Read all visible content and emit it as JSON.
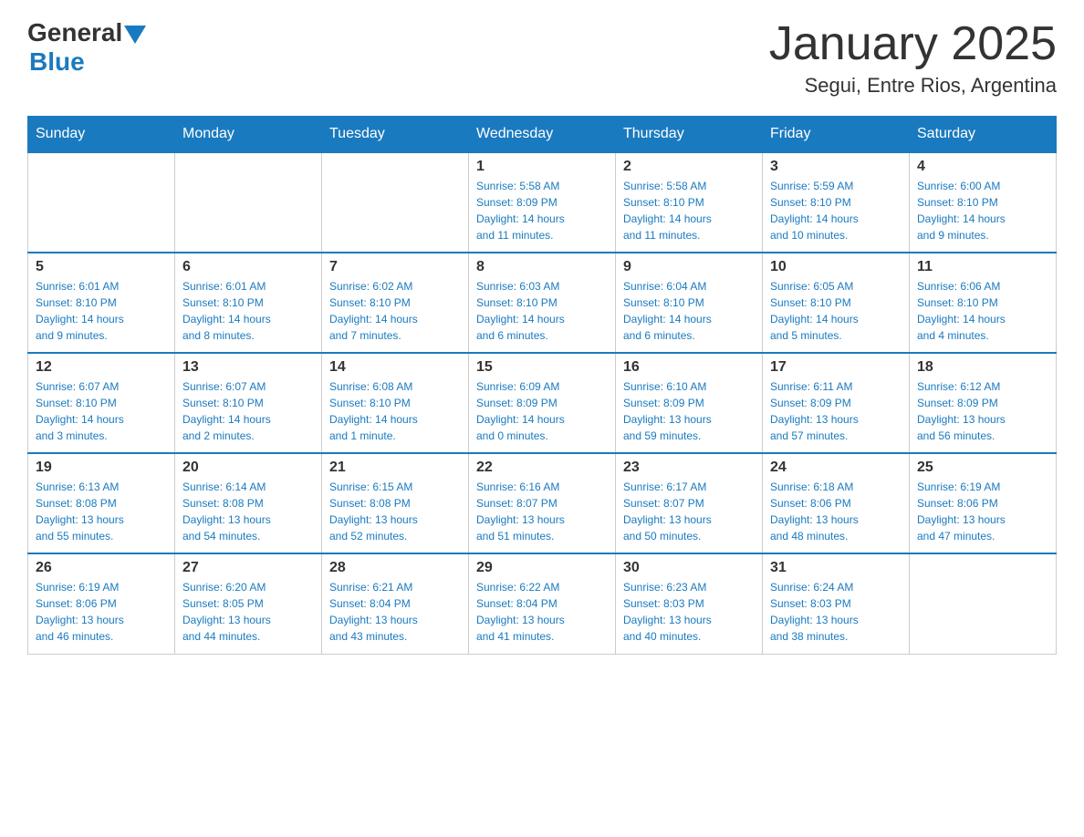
{
  "header": {
    "logo_general": "General",
    "logo_blue": "Blue",
    "title": "January 2025",
    "subtitle": "Segui, Entre Rios, Argentina"
  },
  "columns": [
    "Sunday",
    "Monday",
    "Tuesday",
    "Wednesday",
    "Thursday",
    "Friday",
    "Saturday"
  ],
  "weeks": [
    [
      {
        "day": "",
        "info": ""
      },
      {
        "day": "",
        "info": ""
      },
      {
        "day": "",
        "info": ""
      },
      {
        "day": "1",
        "info": "Sunrise: 5:58 AM\nSunset: 8:09 PM\nDaylight: 14 hours\nand 11 minutes."
      },
      {
        "day": "2",
        "info": "Sunrise: 5:58 AM\nSunset: 8:10 PM\nDaylight: 14 hours\nand 11 minutes."
      },
      {
        "day": "3",
        "info": "Sunrise: 5:59 AM\nSunset: 8:10 PM\nDaylight: 14 hours\nand 10 minutes."
      },
      {
        "day": "4",
        "info": "Sunrise: 6:00 AM\nSunset: 8:10 PM\nDaylight: 14 hours\nand 9 minutes."
      }
    ],
    [
      {
        "day": "5",
        "info": "Sunrise: 6:01 AM\nSunset: 8:10 PM\nDaylight: 14 hours\nand 9 minutes."
      },
      {
        "day": "6",
        "info": "Sunrise: 6:01 AM\nSunset: 8:10 PM\nDaylight: 14 hours\nand 8 minutes."
      },
      {
        "day": "7",
        "info": "Sunrise: 6:02 AM\nSunset: 8:10 PM\nDaylight: 14 hours\nand 7 minutes."
      },
      {
        "day": "8",
        "info": "Sunrise: 6:03 AM\nSunset: 8:10 PM\nDaylight: 14 hours\nand 6 minutes."
      },
      {
        "day": "9",
        "info": "Sunrise: 6:04 AM\nSunset: 8:10 PM\nDaylight: 14 hours\nand 6 minutes."
      },
      {
        "day": "10",
        "info": "Sunrise: 6:05 AM\nSunset: 8:10 PM\nDaylight: 14 hours\nand 5 minutes."
      },
      {
        "day": "11",
        "info": "Sunrise: 6:06 AM\nSunset: 8:10 PM\nDaylight: 14 hours\nand 4 minutes."
      }
    ],
    [
      {
        "day": "12",
        "info": "Sunrise: 6:07 AM\nSunset: 8:10 PM\nDaylight: 14 hours\nand 3 minutes."
      },
      {
        "day": "13",
        "info": "Sunrise: 6:07 AM\nSunset: 8:10 PM\nDaylight: 14 hours\nand 2 minutes."
      },
      {
        "day": "14",
        "info": "Sunrise: 6:08 AM\nSunset: 8:10 PM\nDaylight: 14 hours\nand 1 minute."
      },
      {
        "day": "15",
        "info": "Sunrise: 6:09 AM\nSunset: 8:09 PM\nDaylight: 14 hours\nand 0 minutes."
      },
      {
        "day": "16",
        "info": "Sunrise: 6:10 AM\nSunset: 8:09 PM\nDaylight: 13 hours\nand 59 minutes."
      },
      {
        "day": "17",
        "info": "Sunrise: 6:11 AM\nSunset: 8:09 PM\nDaylight: 13 hours\nand 57 minutes."
      },
      {
        "day": "18",
        "info": "Sunrise: 6:12 AM\nSunset: 8:09 PM\nDaylight: 13 hours\nand 56 minutes."
      }
    ],
    [
      {
        "day": "19",
        "info": "Sunrise: 6:13 AM\nSunset: 8:08 PM\nDaylight: 13 hours\nand 55 minutes."
      },
      {
        "day": "20",
        "info": "Sunrise: 6:14 AM\nSunset: 8:08 PM\nDaylight: 13 hours\nand 54 minutes."
      },
      {
        "day": "21",
        "info": "Sunrise: 6:15 AM\nSunset: 8:08 PM\nDaylight: 13 hours\nand 52 minutes."
      },
      {
        "day": "22",
        "info": "Sunrise: 6:16 AM\nSunset: 8:07 PM\nDaylight: 13 hours\nand 51 minutes."
      },
      {
        "day": "23",
        "info": "Sunrise: 6:17 AM\nSunset: 8:07 PM\nDaylight: 13 hours\nand 50 minutes."
      },
      {
        "day": "24",
        "info": "Sunrise: 6:18 AM\nSunset: 8:06 PM\nDaylight: 13 hours\nand 48 minutes."
      },
      {
        "day": "25",
        "info": "Sunrise: 6:19 AM\nSunset: 8:06 PM\nDaylight: 13 hours\nand 47 minutes."
      }
    ],
    [
      {
        "day": "26",
        "info": "Sunrise: 6:19 AM\nSunset: 8:06 PM\nDaylight: 13 hours\nand 46 minutes."
      },
      {
        "day": "27",
        "info": "Sunrise: 6:20 AM\nSunset: 8:05 PM\nDaylight: 13 hours\nand 44 minutes."
      },
      {
        "day": "28",
        "info": "Sunrise: 6:21 AM\nSunset: 8:04 PM\nDaylight: 13 hours\nand 43 minutes."
      },
      {
        "day": "29",
        "info": "Sunrise: 6:22 AM\nSunset: 8:04 PM\nDaylight: 13 hours\nand 41 minutes."
      },
      {
        "day": "30",
        "info": "Sunrise: 6:23 AM\nSunset: 8:03 PM\nDaylight: 13 hours\nand 40 minutes."
      },
      {
        "day": "31",
        "info": "Sunrise: 6:24 AM\nSunset: 8:03 PM\nDaylight: 13 hours\nand 38 minutes."
      },
      {
        "day": "",
        "info": ""
      }
    ]
  ]
}
